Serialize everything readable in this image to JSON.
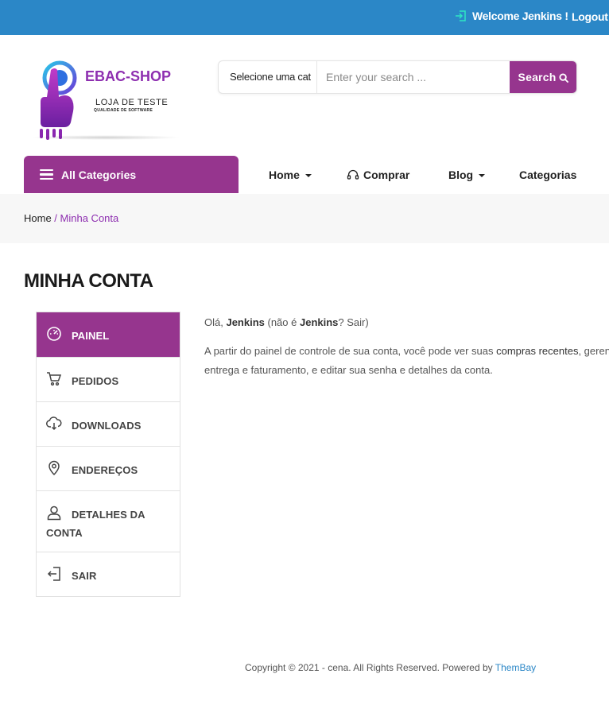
{
  "topbar": {
    "welcome": "Welcome Jenkins !",
    "logout": "Logout"
  },
  "logo": {
    "brand": "EBAC-SHOP",
    "tagline": "LOJA DE TESTE",
    "subtagline": "QUALIDADE DE SOFTWARE"
  },
  "search": {
    "category": "Selecione uma cat",
    "placeholder": "Enter your search ...",
    "button": "Search"
  },
  "nav": {
    "all_categories": "All Categories",
    "items": [
      {
        "label": "Home"
      },
      {
        "label": "Comprar"
      },
      {
        "label": "Blog"
      },
      {
        "label": "Categorias"
      }
    ]
  },
  "breadcrumb": {
    "home": "Home",
    "separator": " / ",
    "current": "Minha Conta"
  },
  "page_title": "MINHA CONTA",
  "account_menu": {
    "items": [
      {
        "label": "PAINEL",
        "icon": "dashboard-icon"
      },
      {
        "label": "PEDIDOS",
        "icon": "cart-icon"
      },
      {
        "label": "DOWNLOADS",
        "icon": "cloud-download-icon"
      },
      {
        "label": "ENDEREÇOS",
        "icon": "location-pin-icon"
      },
      {
        "label": "DETALHES DA",
        "label2": "CONTA",
        "icon": "user-icon"
      },
      {
        "label": "SAIR",
        "icon": "logout-icon"
      }
    ]
  },
  "content": {
    "hello": "Olá, ",
    "user": "Jenkins",
    "not_prefix": " (não é ",
    "not_user": "Jenkins",
    "not_suffix": "? ",
    "sair": "Sair",
    "close": ")",
    "intro_line1": "A partir do painel de controle de sua conta, você pode ver suas ",
    "intro_recent": "compras recentes",
    "intro_line1_end": ", gerenciar seus endereços de",
    "intro_line2": "entrega e faturamento, e editar sua senha e detalhes da conta."
  },
  "footer": {
    "text": "Copyright © 2021 - cena. All Rights Reserved. Powered by ",
    "link": "ThemBay"
  },
  "colors": {
    "topbar": "#2b87c7",
    "accent": "#96358e",
    "brand": "#8e2fb0"
  }
}
